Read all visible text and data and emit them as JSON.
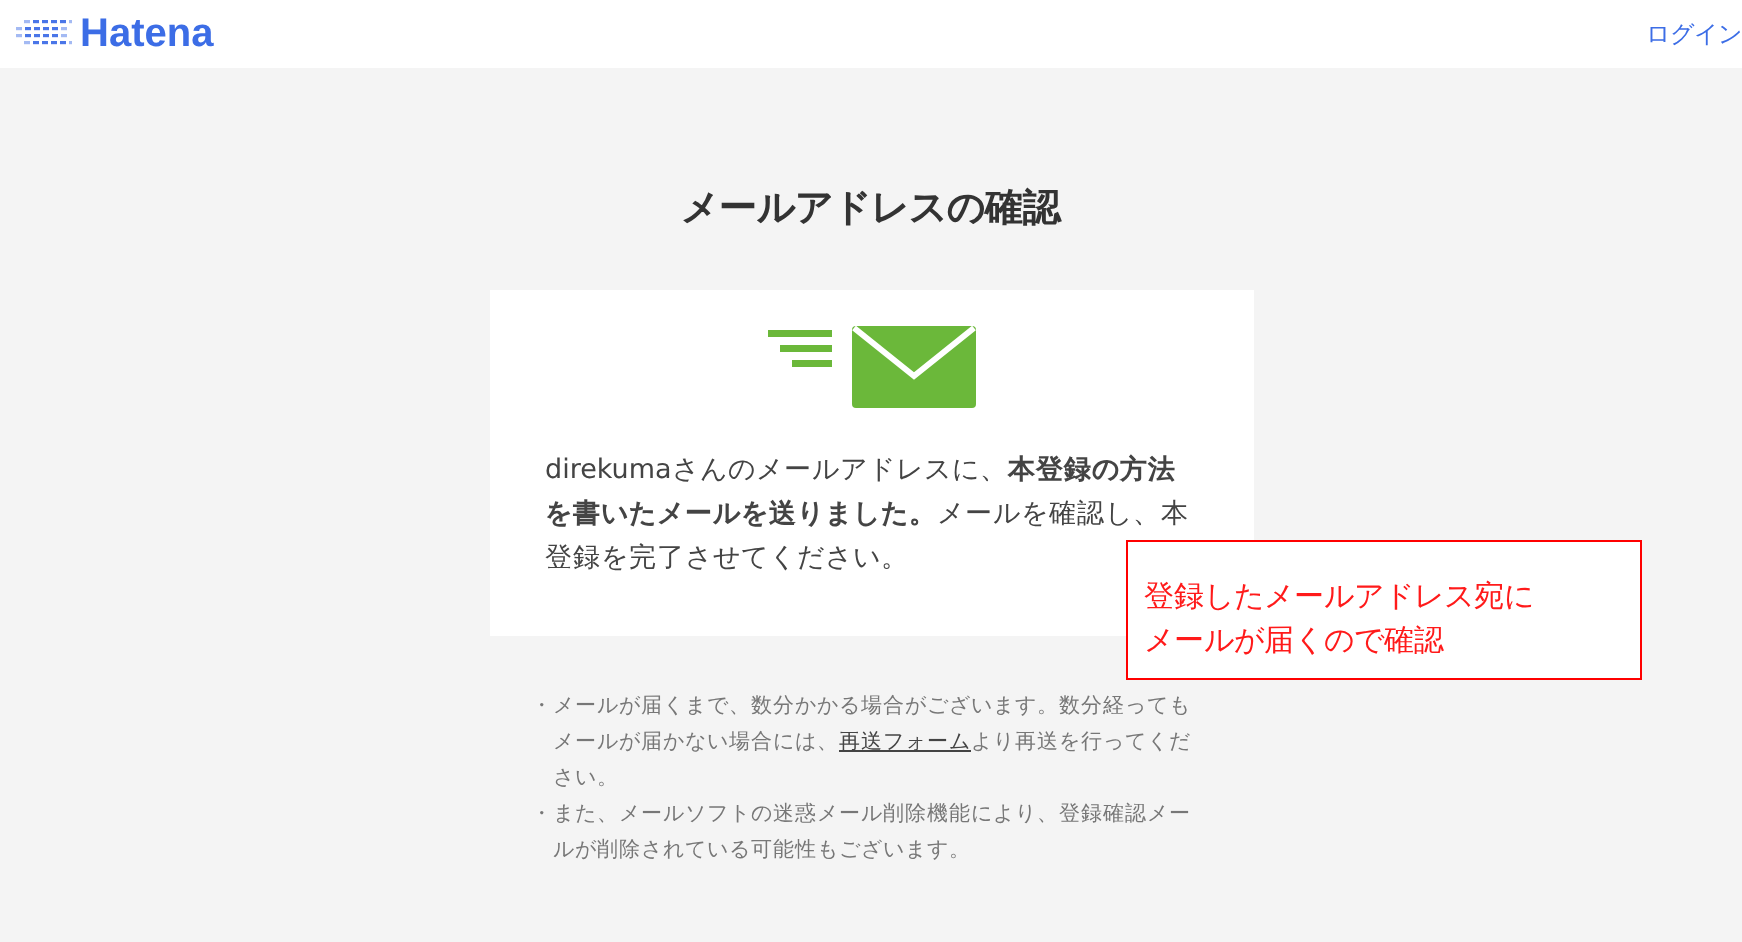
{
  "header": {
    "logo": "Hatena",
    "login_link": "ログイン"
  },
  "title": "メールアドレスの確認",
  "card": {
    "message": "direkumaさんのメールアドレスに、**本登録の方法を書いたメールを送りました。**メールを確認し、本登録を完了させてください。"
  },
  "notes": [
    {
      "bullet": "・",
      "before": "メールが届くまで、数分かかる場合がございます。数分経ってもメールが届かない場合には、",
      "link": "再送フォーム",
      "after": "より再送を行ってください。"
    },
    {
      "bullet": "・",
      "before": "また、メールソフトの迷惑メール削除機能により、登録確認メールが削除されている可能性もございます。"
    }
  ],
  "annotation": {
    "text": "登録したメールアドレス宛にメールが届くので確認"
  }
}
